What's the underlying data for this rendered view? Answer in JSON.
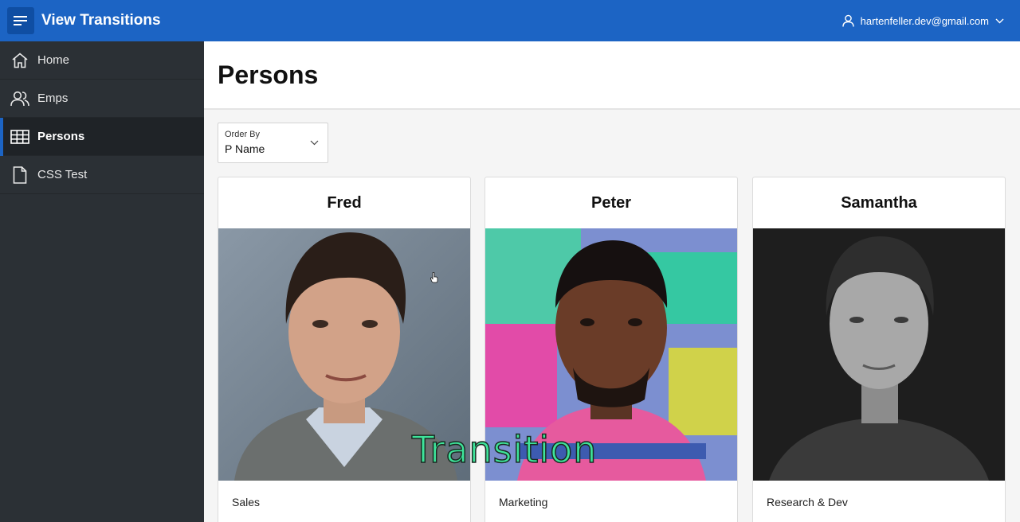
{
  "header": {
    "app_title": "View Transitions",
    "user_email": "hartenfeller.dev@gmail.com",
    "brand_color": "#1c64c4"
  },
  "sidebar": {
    "items": [
      {
        "label": "Home",
        "icon": "home-icon",
        "active": false
      },
      {
        "label": "Emps",
        "icon": "users-icon",
        "active": false
      },
      {
        "label": "Persons",
        "icon": "grid-icon",
        "active": true
      },
      {
        "label": "CSS Test",
        "icon": "file-icon",
        "active": false
      }
    ]
  },
  "main": {
    "page_title": "Persons",
    "order_by": {
      "label": "Order By",
      "value": "P Name"
    },
    "cards": [
      {
        "name": "Fred",
        "department": "Sales"
      },
      {
        "name": "Peter",
        "department": "Marketing"
      },
      {
        "name": "Samantha",
        "department": "Research & Dev"
      }
    ]
  },
  "overlay": {
    "caption": "Transition"
  }
}
